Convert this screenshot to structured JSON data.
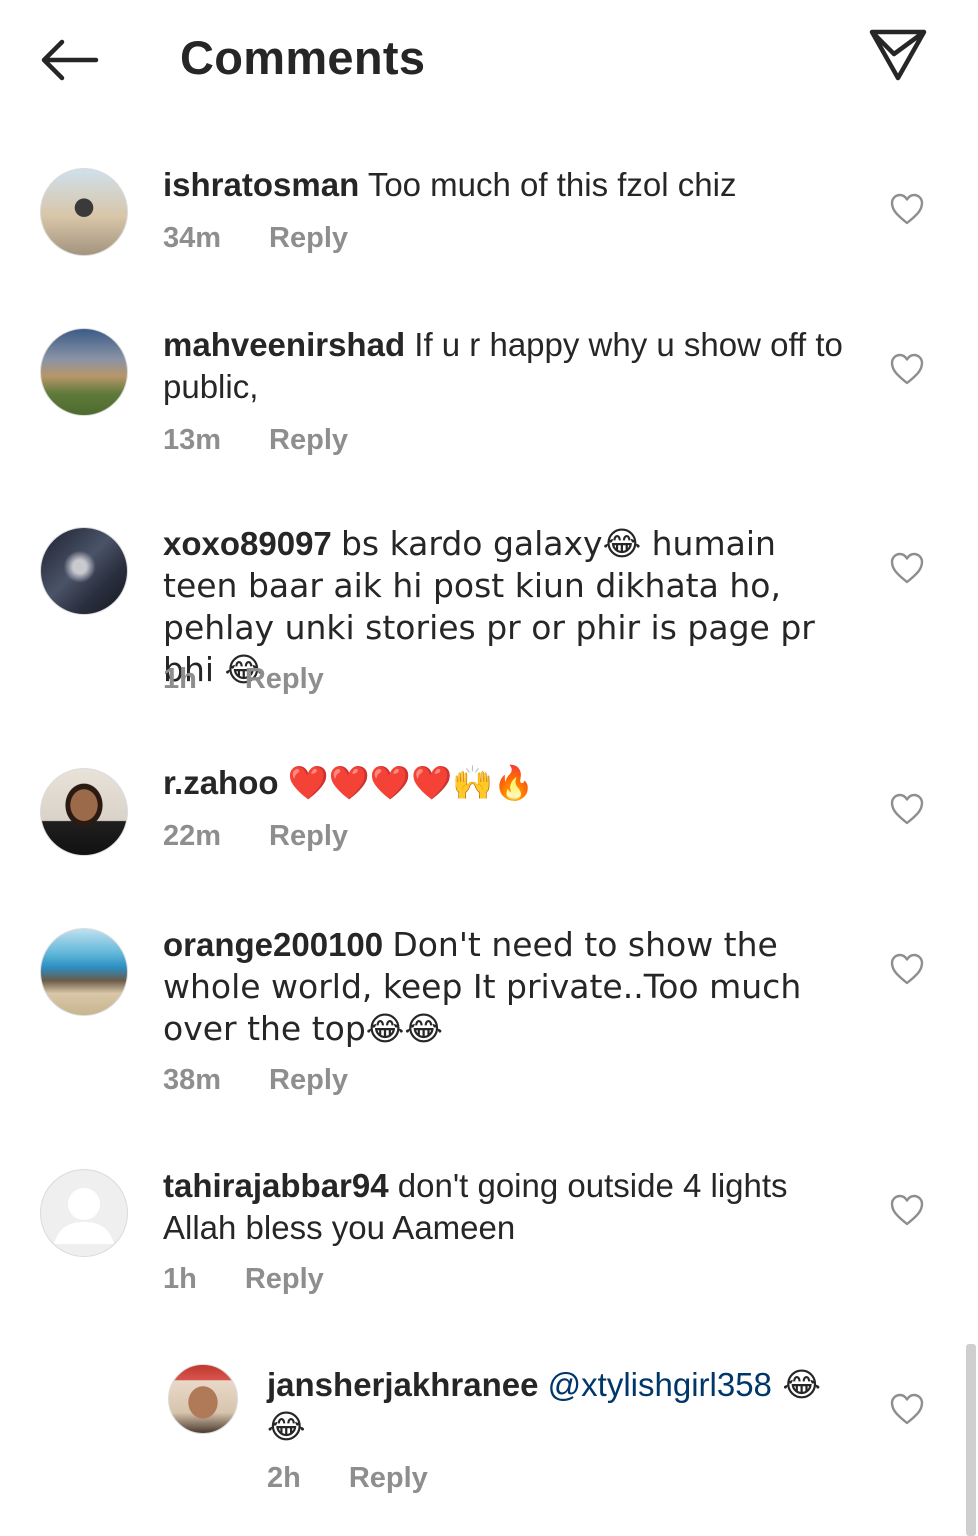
{
  "header": {
    "title": "Comments",
    "back_icon": "arrow-left-icon",
    "send_icon": "paper-plane-icon"
  },
  "reply_label": "Reply",
  "comments": [
    {
      "username": "ishratosman",
      "text": "Too much of this fzol chiz",
      "time": "34m"
    },
    {
      "username": "mahveenirshad",
      "text": "If u r happy why u show off to public,",
      "time": "13m"
    },
    {
      "username": "xoxo89097",
      "text": "bs kardo galaxy😂 humain teen baar aik hi post kiun dikhata ho, pehlay unki stories pr or phir is page pr bhi 😂",
      "time": "1h"
    },
    {
      "username": "r.zahoo",
      "text": "❤️❤️❤️❤️🙌🔥",
      "time": "22m"
    },
    {
      "username": "orange200100",
      "text": "Don't need to show the whole world, keep It private..Too much over the top😂😂",
      "time": "38m"
    },
    {
      "username": "tahirajabbar94",
      "text": "don't going outside 4 lights Allah bless you Aameen",
      "time": "1h"
    },
    {
      "username": "jansherjakhranee",
      "mention": "@xtylishgirl358",
      "text": " 😂 😂",
      "time": "2h",
      "is_reply": true
    }
  ]
}
